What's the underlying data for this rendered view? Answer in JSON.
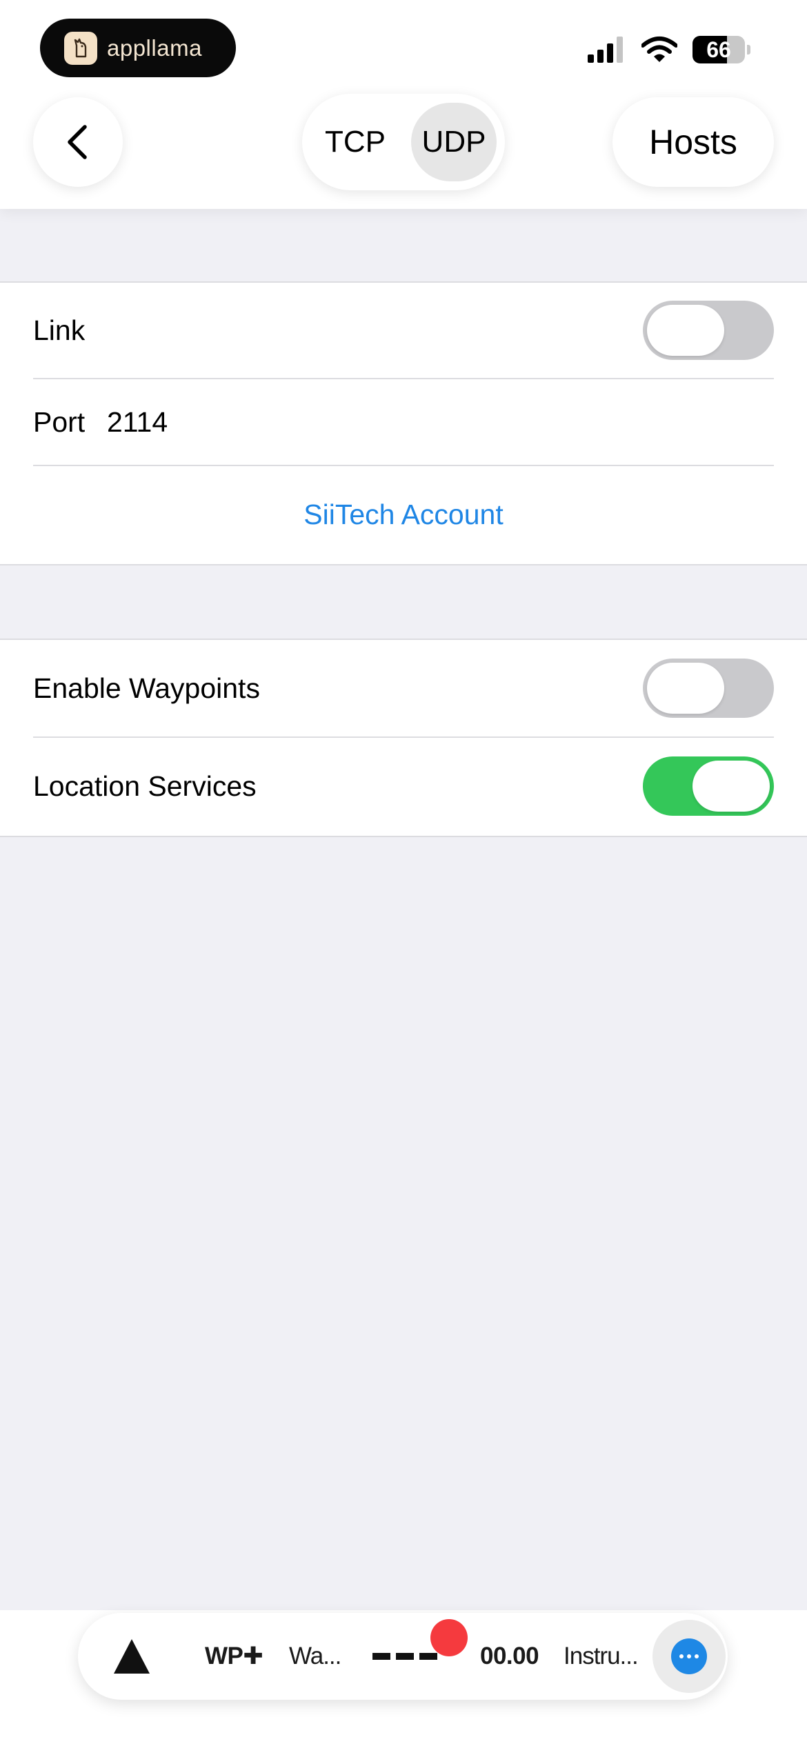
{
  "status_bar": {
    "app_name": "appllama",
    "battery_level": "66",
    "battery_fraction": 0.66
  },
  "nav": {
    "back_icon": "chevron-left-icon",
    "segments": [
      {
        "label": "TCP",
        "selected": false
      },
      {
        "label": "UDP",
        "selected": true
      }
    ],
    "hosts_label": "Hosts"
  },
  "connection": {
    "link_label": "Link",
    "link_on": false,
    "port_label": "Port",
    "port_value": "2114",
    "account_link": "SiiTech Account"
  },
  "settings": {
    "waypoints_label": "Enable Waypoints",
    "waypoints_on": false,
    "location_label": "Location Services",
    "location_on": true
  },
  "toolbar": {
    "arrow_icon": "triangle-up-icon",
    "wp_label": "WP✚",
    "wa_label": "Wa...",
    "dashes_icon": "dashes-icon",
    "record_dot": "red-dot-icon",
    "value": "00.00",
    "instru_label": "Instru...",
    "more_icon": "ellipsis-circle-icon"
  },
  "colors": {
    "accent_blue": "#1F86E5",
    "toggle_on": "#34C759",
    "toggle_off": "#C9C9CC",
    "record_red": "#F53A3E",
    "background": "#F0F0F5"
  }
}
